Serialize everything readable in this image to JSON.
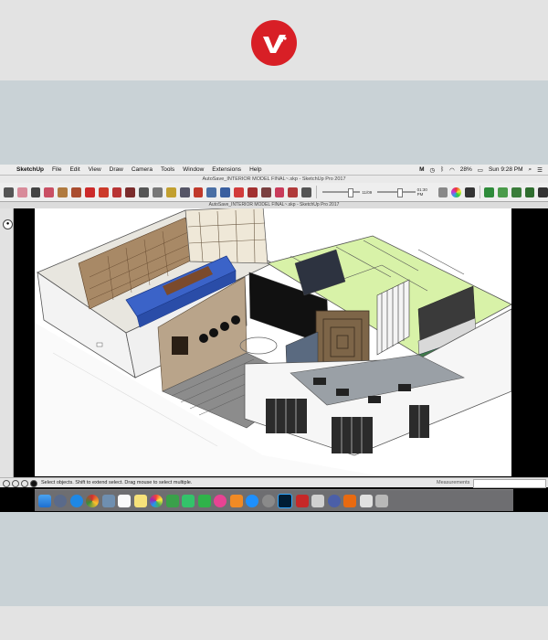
{
  "menubar": {
    "apple": "",
    "items": [
      "SketchUp",
      "File",
      "Edit",
      "View",
      "Draw",
      "Camera",
      "Tools",
      "Window",
      "Extensions",
      "Help"
    ],
    "status_battery": "28%",
    "status_time": "Sun 9:28 PM"
  },
  "window_title": "AutoSave_INTERIOR MODEL FINAL~.skp - SketchUp Pro 2017",
  "document_title": "AutoSave_INTERIOR MODEL FINAL~.skp - SketchUp Pro 2017",
  "toolbar": {
    "shadow_time_left": "11/09",
    "shadow_time_right": "01:30 PM",
    "tool_icons": [
      "select-icon",
      "eraser-icon",
      "pencil-icon",
      "arc-icon",
      "rectangle-icon",
      "push-pull-icon",
      "move-icon",
      "rotate-icon",
      "scale-icon",
      "offset-icon",
      "tape-measure-icon",
      "text-icon",
      "axes-icon",
      "3d-text-icon",
      "paint-bucket-icon",
      "orbit-icon",
      "pan-icon",
      "zoom-icon",
      "zoom-extents-icon",
      "previous-view-icon",
      "section-plane-icon",
      "walk-icon",
      "look-around-icon",
      "position-camera-icon"
    ]
  },
  "status": {
    "message": "Select objects. Shift to extend select. Drag mouse to select multiple.",
    "measurements_label": "Measurements"
  },
  "dock_icons": [
    "finder-icon",
    "launchpad-icon",
    "safari-icon",
    "chrome-icon",
    "preview-icon",
    "calendar-icon",
    "notes-icon",
    "photos-icon",
    "numbers-icon",
    "messages-icon",
    "facetime-icon",
    "itunes-icon",
    "ibooks-icon",
    "app-store-icon",
    "system-preferences-icon",
    "photoshop-icon",
    "autocad-icon",
    "sketchup-icon",
    "quicktime-icon",
    "vlc-icon",
    "downloads-icon",
    "trash-icon"
  ],
  "colors": {
    "brand_red": "#d81f26",
    "menubar_bg": "#ececec",
    "viewport_bg": "#ffffff"
  }
}
